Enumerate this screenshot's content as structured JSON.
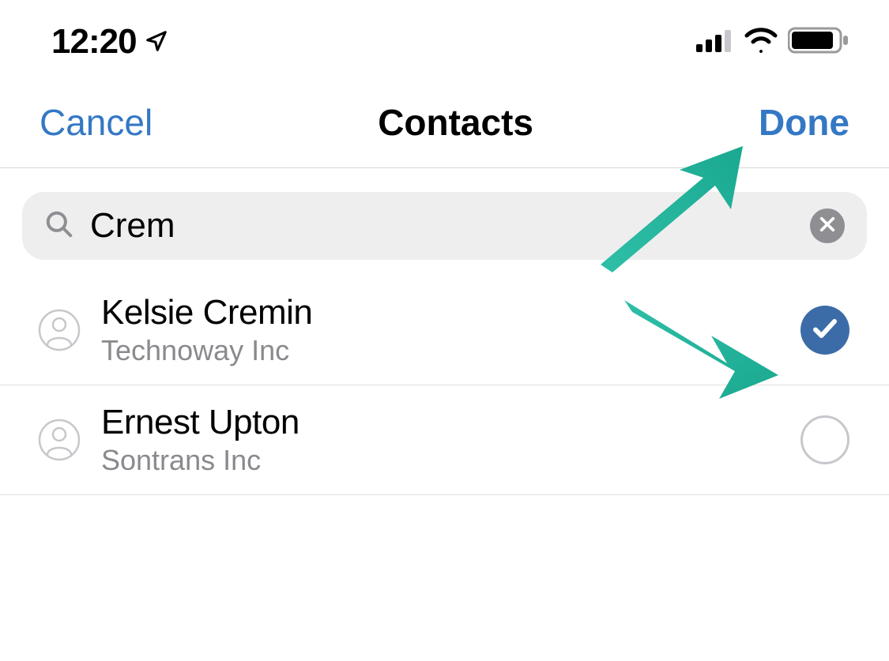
{
  "status_bar": {
    "time": "12:20"
  },
  "nav": {
    "cancel_label": "Cancel",
    "title": "Contacts",
    "done_label": "Done"
  },
  "search": {
    "value": "Crem"
  },
  "contacts": [
    {
      "name": "Kelsie Cremin",
      "company": "Technoway Inc",
      "selected": true
    },
    {
      "name": "Ernest Upton",
      "company": "Sontrans Inc",
      "selected": false
    }
  ]
}
